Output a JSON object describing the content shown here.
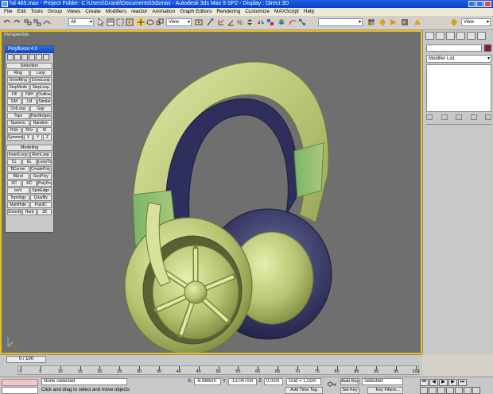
{
  "window": {
    "title": "hd 485.max  -  Project Folder: C:\\Users\\Gran6\\Documents\\3dsmax  -  Autodesk 3ds Max 9 SP2  -  Display : Direct 3D"
  },
  "menu": [
    "File",
    "Edit",
    "Tools",
    "Group",
    "Views",
    "Create",
    "Modifiers",
    "reactor",
    "Animation",
    "Graph Editors",
    "Rendering",
    "Customize",
    "MAXScript",
    "Help"
  ],
  "toolbar": {
    "filter_value": "All",
    "refcoord_value": "View",
    "view_value": "View"
  },
  "viewport": {
    "label": "Perspective"
  },
  "polyboost": {
    "title": "PolyBoost 4.0",
    "selection_header": "Selection",
    "selection_rows": [
      [
        "Ring",
        "Loop"
      ],
      [
        "GrowRing",
        "GrowLoop"
      ],
      [
        "StepMode",
        "StepLoop"
      ],
      [
        "Fill",
        "FillH",
        "Outline"
      ],
      [
        "RM",
        "LM",
        "Similar"
      ],
      [
        "DotLoop",
        "Gap"
      ],
      [
        "Tops",
        "HardEdges"
      ],
      [
        "Numeric",
        "Random"
      ],
      [
        "RSh",
        "RGr",
        "ID"
      ],
      [
        "Symmetry",
        "X",
        "Y",
        "Z"
      ]
    ],
    "modeling_header": "Modeling",
    "modeling_rows": [
      [
        "InsertLoop",
        "RemLoop"
      ],
      [
        "CL",
        "EL",
        "LoopTools"
      ],
      [
        "BCorner",
        "CreatePoly"
      ],
      [
        "BEnd",
        "GeoPoly"
      ],
      [
        "DC",
        "RC",
        "PolyDraw"
      ],
      [
        "IsoV",
        "SpinEdge"
      ],
      [
        "Topology",
        "Quadify"
      ],
      [
        "MultiHide",
        "PaintC"
      ],
      [
        "Smooth",
        "Hard",
        "30"
      ]
    ]
  },
  "command_panel": {
    "modifier_list": "Modifier List"
  },
  "timeline": {
    "slider_text": "0 / 100",
    "ticks": [
      0,
      5,
      10,
      15,
      20,
      25,
      30,
      35,
      40,
      45,
      50,
      55,
      60,
      65,
      70,
      75,
      80,
      85,
      90,
      95,
      100
    ]
  },
  "status": {
    "selection": "None Selected",
    "prompt": "Click and drag to select and move objects",
    "x_label": "X:",
    "x_value": "-6.988cm",
    "y_label": "Y:",
    "y_value": "-13.047cm",
    "z_label": "Z:",
    "z_value": "0.0cm",
    "grid": "Grid = 1,0cm",
    "add_time_tag": "Add Time Tag",
    "auto_key": "Auto Key",
    "set_key": "Set Key",
    "key_mode_value": "Selected",
    "key_filters": "Key Filters..."
  }
}
